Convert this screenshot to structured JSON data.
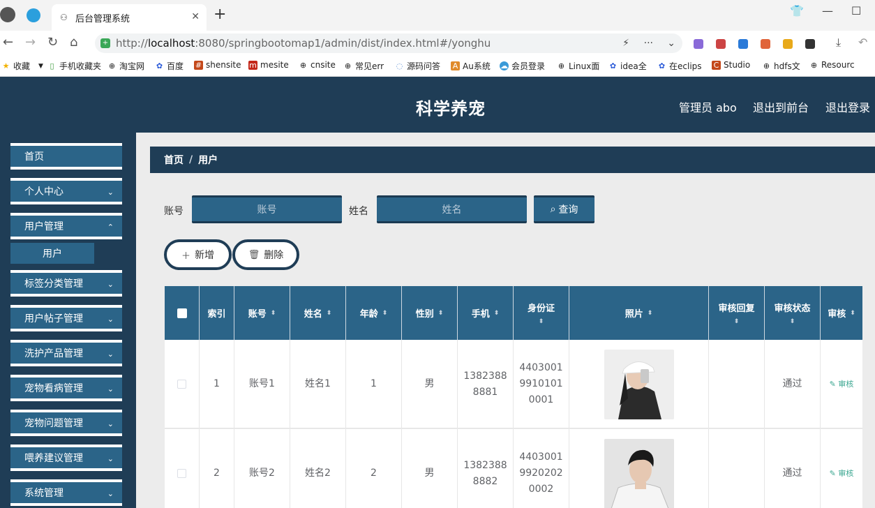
{
  "browser": {
    "tab_title": "后台管理系统",
    "url_prefix": "http://",
    "url_host": "localhost",
    "url_rest": ":8080/springbootomap1/admin/dist/index.html#/yonghu",
    "bookmarks": [
      "收藏",
      "手机收藏夹",
      "淘宝网",
      "百度",
      "shensite",
      "mesite",
      "cnsite",
      "常见err",
      "源码问答",
      "Au系统",
      "会员登录",
      "Linux面",
      "idea全",
      "在eclips",
      "Studio",
      "hdfs文",
      "Resourc"
    ]
  },
  "header": {
    "title": "科学养宠",
    "admin_label": "管理员 abo",
    "front_link": "退出到前台",
    "logout_link": "退出登录"
  },
  "sidebar": {
    "items": [
      {
        "label": "首页"
      },
      {
        "label": "个人中心"
      },
      {
        "label": "用户管理"
      },
      {
        "label": "标签分类管理"
      },
      {
        "label": "用户帖子管理"
      },
      {
        "label": "洗护产品管理"
      },
      {
        "label": "宠物看病管理"
      },
      {
        "label": "宠物问题管理"
      },
      {
        "label": "喂养建议管理"
      },
      {
        "label": "系统管理"
      }
    ],
    "sub_item": "用户"
  },
  "breadcrumb": {
    "home": "首页",
    "sep": "/",
    "current": "用户"
  },
  "search": {
    "account_label": "账号",
    "account_placeholder": "账号",
    "name_label": "姓名",
    "name_placeholder": "姓名",
    "query_button": "查询"
  },
  "actions": {
    "add": "新增",
    "delete": "删除"
  },
  "table": {
    "headers": [
      "索引",
      "账号",
      "姓名",
      "年龄",
      "性别",
      "手机",
      "身份证",
      "照片",
      "审核回复",
      "审核状态",
      "审核"
    ],
    "rows": [
      {
        "index": "1",
        "account": "账号1",
        "name": "姓名1",
        "age": "1",
        "gender": "男",
        "phone_a": "1382388",
        "phone_b": "8881",
        "id_a": "4403001",
        "id_b": "9910101",
        "id_c": "0001",
        "reply": "",
        "status": "通过",
        "audit": "审核"
      },
      {
        "index": "2",
        "account": "账号2",
        "name": "姓名2",
        "age": "2",
        "gender": "男",
        "phone_a": "1382388",
        "phone_b": "8882",
        "id_a": "4403001",
        "id_b": "9920202",
        "id_c": "0002",
        "reply": "",
        "status": "通过",
        "audit": "审核"
      }
    ]
  }
}
